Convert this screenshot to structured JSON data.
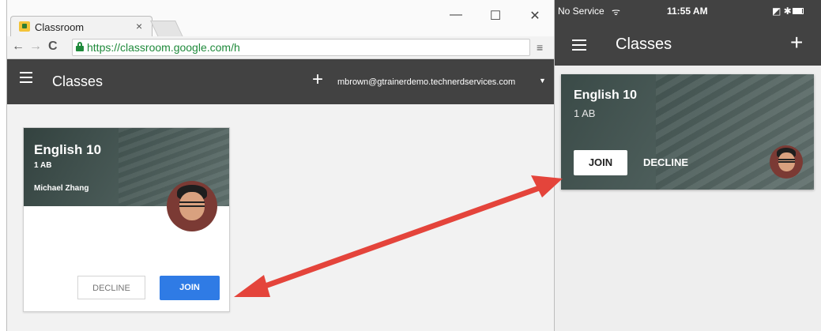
{
  "browser": {
    "tab_title": "Classroom",
    "tab_close": "×",
    "url_secure": "https://classroom.google.com/h",
    "url_rest": "",
    "window_controls": {
      "minimize": "—",
      "maximize": "☐",
      "close": "✕"
    }
  },
  "web_app": {
    "title": "Classes",
    "plus": "+",
    "account": "mbrown@gtrainerdemo.technerdservices.com"
  },
  "web_card": {
    "title": "English 10",
    "section": "1 AB",
    "teacher": "Michael Zhang",
    "decline_label": "DECLINE",
    "join_label": "JOIN"
  },
  "mobile": {
    "carrier": "No Service",
    "time": "11:55 AM",
    "title": "Classes",
    "plus": "+"
  },
  "mobile_card": {
    "title": "English 10",
    "section": "1 AB",
    "join_label": "JOIN",
    "decline_label": "DECLINE"
  },
  "colors": {
    "appbar": "#424242",
    "join_blue": "#2f7be5",
    "secure_green": "#1f8a3b",
    "arrow_red": "#e4443b"
  },
  "icons": [
    "classroom-favicon",
    "back-arrow-icon",
    "forward-arrow-icon",
    "reload-icon",
    "lock-icon",
    "menu-icon",
    "hamburger-icon",
    "plus-icon",
    "caret-down-icon",
    "wifi-icon",
    "bluetooth-icon",
    "battery-icon",
    "teacher-avatar",
    "annotation-arrow"
  ]
}
